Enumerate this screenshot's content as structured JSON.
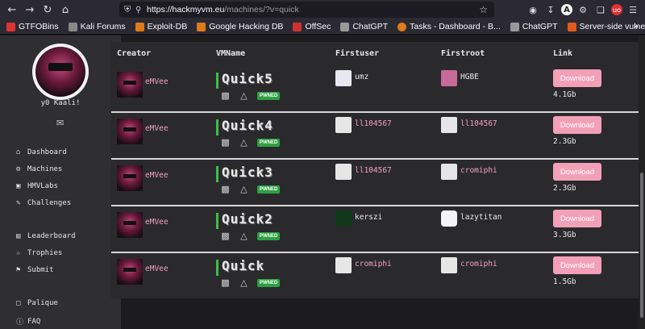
{
  "browser": {
    "url_host": "https://hackmyvm.eu",
    "url_path": "/machines/?v=quick",
    "bookmarks": [
      {
        "label": "GTFOBins",
        "color": "#d33"
      },
      {
        "label": "Kali Forums",
        "color": "#888"
      },
      {
        "label": "Exploit-DB",
        "color": "#e07a1a"
      },
      {
        "label": "Google Hacking DB",
        "color": "#e07a1a"
      },
      {
        "label": "OffSec",
        "color": "#c33"
      },
      {
        "label": "ChatGPT",
        "color": "#999"
      },
      {
        "label": "Tasks - Dashboard - B...",
        "color": "#e07a1a"
      },
      {
        "label": "ChatGPT",
        "color": "#999"
      },
      {
        "label": "Server-side vulnerabili...",
        "color": "#e05a1a"
      }
    ]
  },
  "sidebar": {
    "greeting": "y0 Kaali!",
    "items": [
      {
        "label": "Dashboard",
        "icon": "home-icon"
      },
      {
        "label": "Machines",
        "icon": "gear-icon"
      },
      {
        "label": "HMVLabs",
        "icon": "lab-icon"
      },
      {
        "label": "Challenges",
        "icon": "puzzle-icon"
      },
      {
        "label": "Leaderboard",
        "icon": "bar-chart-icon"
      },
      {
        "label": "Trophies",
        "icon": "trophy-icon"
      },
      {
        "label": "Submit",
        "icon": "flag-icon"
      },
      {
        "label": "Palique",
        "icon": "chat-icon"
      },
      {
        "label": "FAQ",
        "icon": "help-icon"
      }
    ]
  },
  "table": {
    "headers": [
      "Creator",
      "VMName",
      "Firstuser",
      "Firstroot",
      "Link"
    ],
    "pwned_label": "PWNED",
    "download_label": "Download",
    "rows": [
      {
        "creator": "eMVee",
        "vm": "Quick5",
        "firstuser": "umz",
        "firstroot": "HGBE",
        "size": "4.1Gb"
      },
      {
        "creator": "eMVee",
        "vm": "Quick4",
        "firstuser": "ll104567",
        "firstroot": "ll104567",
        "size": "2.3Gb"
      },
      {
        "creator": "eMVee",
        "vm": "Quick3",
        "firstuser": "ll104567",
        "firstroot": "cromiphi",
        "size": "2.3Gb"
      },
      {
        "creator": "eMVee",
        "vm": "Quick2",
        "firstuser": "kerszi",
        "firstroot": "lazytitan",
        "size": "3.3Gb"
      },
      {
        "creator": "eMVee",
        "vm": "Quick",
        "firstuser": "cromiphi",
        "firstroot": "cromiphi",
        "size": "1.5Gb"
      }
    ]
  },
  "colors": {
    "accent_pink": "#f2a0b7",
    "pwned_green": "#2ea043",
    "vm_bar_green": "#3bbf4b"
  }
}
